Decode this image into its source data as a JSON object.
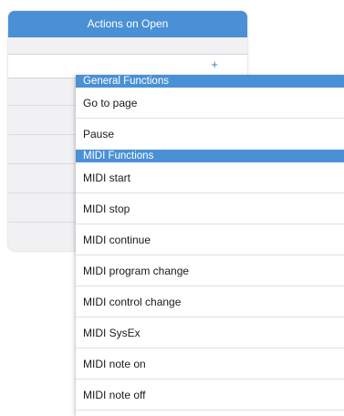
{
  "panel": {
    "title": "Actions on Open",
    "add_label": "+"
  },
  "menu": {
    "sections": [
      {
        "header": "General Functions",
        "items": [
          "Go to page",
          "Pause"
        ]
      },
      {
        "header": "MIDI Functions",
        "items": [
          "MIDI start",
          "MIDI stop",
          "MIDI continue",
          "MIDI program change",
          "MIDI control change",
          "MIDI SysEx",
          "MIDI note on",
          "MIDI note off"
        ]
      }
    ]
  },
  "colors": {
    "accent": "#4a90d5",
    "panel_background": "#f1f1f3",
    "menu_background": "#ffffff"
  }
}
